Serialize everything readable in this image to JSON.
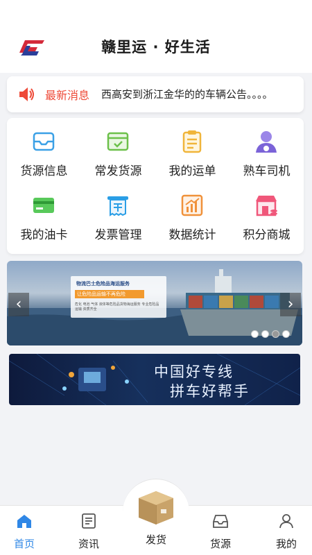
{
  "header": {
    "title": "赣里运 · 好生活"
  },
  "notice": {
    "label": "最新消息",
    "text": "西高安到浙江金华的的车辆公告。。。。"
  },
  "grid": {
    "items": [
      {
        "label": "货源信息",
        "icon": "tray-icon"
      },
      {
        "label": "常发货源",
        "icon": "box-check-icon"
      },
      {
        "label": "我的运单",
        "icon": "clipboard-icon"
      },
      {
        "label": "熟车司机",
        "icon": "driver-icon"
      },
      {
        "label": "我的油卡",
        "icon": "card-icon"
      },
      {
        "label": "发票管理",
        "icon": "receipt-icon"
      },
      {
        "label": "数据统计",
        "icon": "chart-icon"
      },
      {
        "label": "积分商城",
        "icon": "shop-icon"
      }
    ]
  },
  "banner": {
    "tag_title": "物流巴士危险品海运服务",
    "tag_slogan": "让危险品运输不再危险",
    "tag_body": "危化 电池 气体 液体等危险品货物海运服务 专业危险品运输 资质齐全",
    "slides": 4,
    "active_slide": 3
  },
  "banner2": {
    "line1": "中国好专线",
    "line2": "拼车好帮手"
  },
  "tabbar": {
    "home": "首页",
    "news": "资讯",
    "ship": "发货",
    "goods": "货源",
    "mine": "我的"
  },
  "colors": {
    "accent": "#2f87e6",
    "notice_red": "#ee4a38"
  }
}
